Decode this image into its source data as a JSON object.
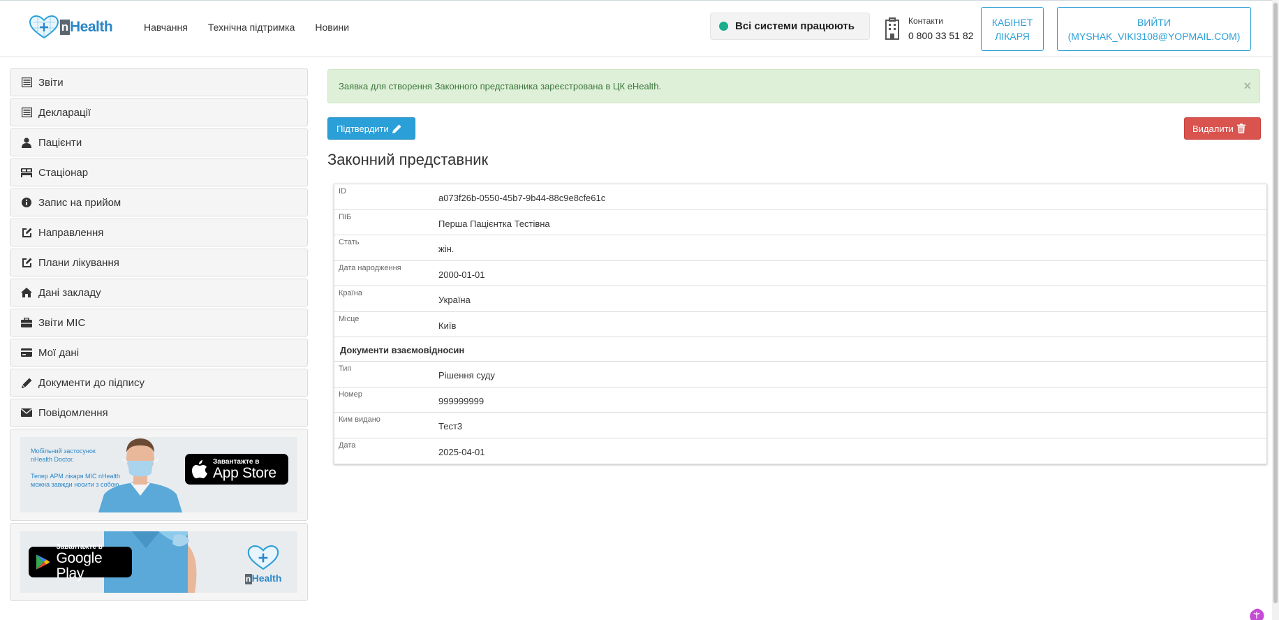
{
  "header": {
    "logo_text": "Health",
    "logo_letter": "n",
    "nav": [
      "Навчання",
      "Технічна підтримка",
      "Новини"
    ],
    "status": "Всі системи працюють",
    "contacts_label": "Контакти",
    "contacts_phone": "0 800 33 51 82",
    "cabinet_button": "КАБІНЕТ ЛІКАРЯ",
    "logout_line1": "ВИЙТИ",
    "logout_line2": "(MYSHAK_VIKI3108@YOPMAIL.COM)"
  },
  "sidebar": {
    "items": [
      {
        "label": "Звіти",
        "icon": "list-icon"
      },
      {
        "label": "Декларації",
        "icon": "list-icon"
      },
      {
        "label": "Пацієнти",
        "icon": "user-icon"
      },
      {
        "label": "Стаціонар",
        "icon": "bed-icon"
      },
      {
        "label": "Запис на прийом",
        "icon": "info-icon"
      },
      {
        "label": "Направлення",
        "icon": "edit-icon"
      },
      {
        "label": "Плани лікування",
        "icon": "edit-icon"
      },
      {
        "label": "Дані закладу",
        "icon": "home-icon"
      },
      {
        "label": "Звіти МІС",
        "icon": "briefcase-icon"
      },
      {
        "label": "Мої дані",
        "icon": "card-icon"
      },
      {
        "label": "Документи до підпису",
        "icon": "pencil-icon"
      },
      {
        "label": "Повідомлення",
        "icon": "envelope-icon"
      }
    ],
    "promo1": {
      "text_line1": "Мобільний застосунок",
      "text_line2": "nHealth Doctor.",
      "text_line3": "Тепер АРМ лікаря МІС nHealth",
      "text_line4": "можна завжди носити з собою",
      "store_small": "Завантажте в",
      "store_big": "App Store"
    },
    "promo2": {
      "store_small": "Завантажте в",
      "store_big": "Google Play",
      "logo_letter": "n",
      "logo_text": "Health"
    }
  },
  "main": {
    "alert": "Заявка для створення Законного представника зареєстрована в ЦК eHealth.",
    "alert_close": "×",
    "confirm_button": "Підтвердити",
    "delete_button": "Видалити",
    "title": "Законний представник",
    "fields": [
      {
        "label": "ID",
        "value": "a073f26b-0550-45b7-9b44-88c9e8cfe61c"
      },
      {
        "label": "ПІБ",
        "value": "Перша Пацієнтка Тестівна"
      },
      {
        "label": "Стать",
        "value": "жін."
      },
      {
        "label": "Дата народження",
        "value": "2000-01-01"
      },
      {
        "label": "Країна",
        "value": "Україна"
      },
      {
        "label": "Місце",
        "value": "Київ"
      }
    ],
    "section_title": "Документи взаємовідносин",
    "doc_fields": [
      {
        "label": "Тип",
        "value": "Рішення суду"
      },
      {
        "label": "Номер",
        "value": "999999999"
      },
      {
        "label": "Ким видано",
        "value": "Тест3"
      },
      {
        "label": "Дата",
        "value": "2025-04-01"
      }
    ]
  },
  "colors": {
    "primary": "#2a9fd8",
    "danger": "#d9534f",
    "success_bg": "#dff0d8",
    "success_text": "#3c763d",
    "status_dot": "#1aae8d"
  }
}
